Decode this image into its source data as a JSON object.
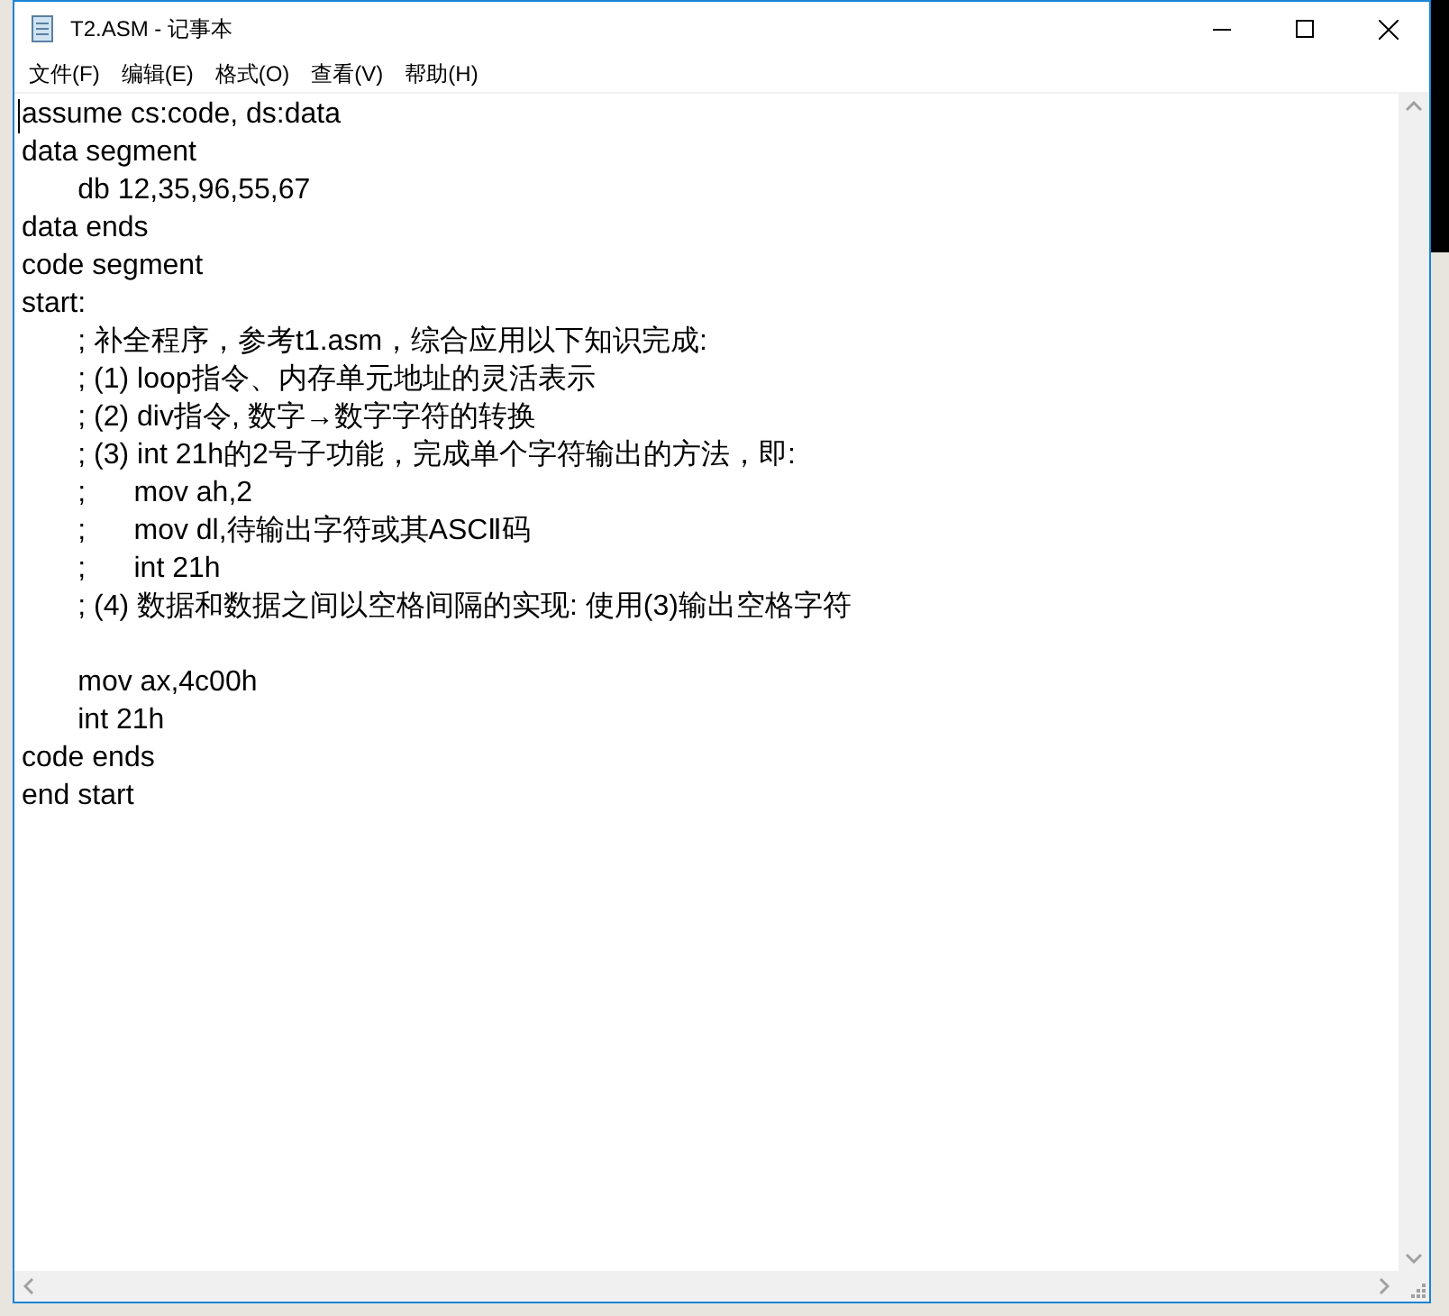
{
  "window": {
    "title": "T2.ASM - 记事本"
  },
  "menu": [
    "文件(F)",
    "编辑(E)",
    "格式(O)",
    "查看(V)",
    "帮助(H)"
  ],
  "editor": {
    "lines": [
      {
        "kind": "text",
        "text": "assume cs:code, ds:data"
      },
      {
        "kind": "text",
        "text": "data segment"
      },
      {
        "kind": "text",
        "text": "\tdb 12,35,96,55,67"
      },
      {
        "kind": "text",
        "text": "data ends"
      },
      {
        "kind": "text",
        "text": "code segment"
      },
      {
        "kind": "text",
        "text": "start:"
      },
      {
        "kind": "text",
        "text": "\t; 补全程序，参考t1.asm，综合应用以下知识完成:"
      },
      {
        "kind": "text",
        "text": "\t; (1) loop指令、内存单元地址的灵活表示"
      },
      {
        "kind": "text",
        "text": "\t; (2) div指令, 数字→数字字符的转换"
      },
      {
        "kind": "text",
        "text": "\t; (3) int 21h的2号子功能，完成单个字符输出的方法，即:"
      },
      {
        "kind": "text",
        "text": "\t;\tmov ah,2"
      },
      {
        "kind": "text",
        "text": "\t;\tmov dl,待输出字符或其ASCⅡ码"
      },
      {
        "kind": "text",
        "text": "\t;\tint 21h"
      },
      {
        "kind": "text",
        "text": "\t; (4) 数据和数据之间以空格间隔的实现: 使用(3)输出空格字符"
      },
      {
        "kind": "blank"
      },
      {
        "kind": "text",
        "text": "\tmov ax,4c00h"
      },
      {
        "kind": "text",
        "text": "\tint 21h"
      },
      {
        "kind": "text",
        "text": "code ends"
      },
      {
        "kind": "text",
        "text": "end start"
      }
    ]
  }
}
